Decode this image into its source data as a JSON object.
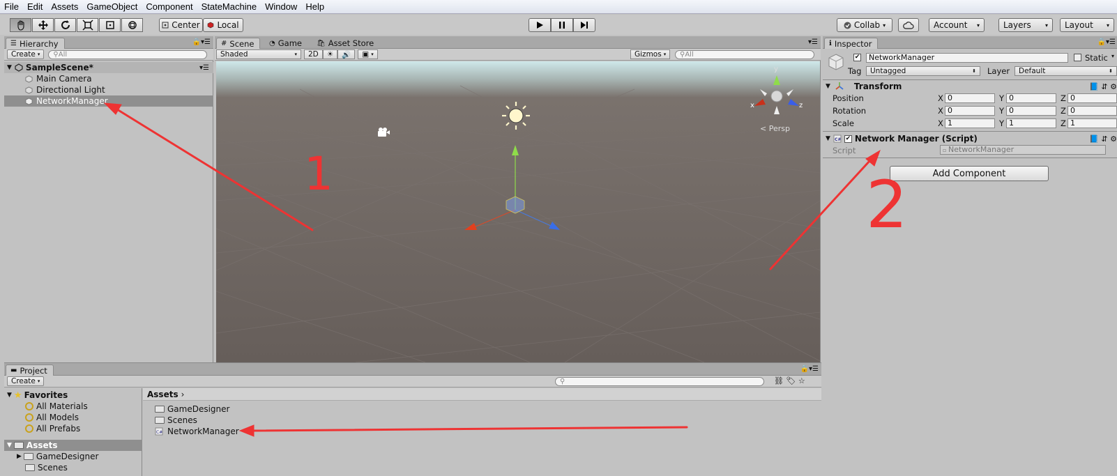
{
  "menu": [
    "File",
    "Edit",
    "Assets",
    "GameObject",
    "Component",
    "StateMachine",
    "Window",
    "Help"
  ],
  "toolbar": {
    "pivot_label": "Center",
    "space_label": "Local",
    "collab_label": "Collab",
    "account_label": "Account",
    "layers_label": "Layers",
    "layout_label": "Layout",
    "play_icon": "play-icon",
    "pause_icon": "pause-icon",
    "step_icon": "step-icon"
  },
  "hierarchy": {
    "tab": "Hierarchy",
    "create": "Create",
    "search_placeholder": "All",
    "scene": "SampleScene*",
    "items": [
      "Main Camera",
      "Directional Light",
      "NetworkManager"
    ],
    "selected_index": 2
  },
  "scene": {
    "tabs": [
      "Scene",
      "Game",
      "Asset Store"
    ],
    "shading": "Shaded",
    "mode_2d": "2D",
    "gizmos": "Gizmos",
    "search_placeholder": "All",
    "persp_label": "Persp",
    "axis_x": "x",
    "axis_y": "y",
    "axis_z": "z"
  },
  "inspector": {
    "tab": "Inspector",
    "object_name": "NetworkManager",
    "static_label": "Static",
    "tag_label": "Tag",
    "tag_value": "Untagged",
    "layer_label": "Layer",
    "layer_value": "Default",
    "transform": {
      "title": "Transform",
      "rows": [
        {
          "label": "Position",
          "x": "0",
          "y": "0",
          "z": "0"
        },
        {
          "label": "Rotation",
          "x": "0",
          "y": "0",
          "z": "0"
        },
        {
          "label": "Scale",
          "x": "1",
          "y": "1",
          "z": "1"
        }
      ],
      "axis_labels": [
        "X",
        "Y",
        "Z"
      ]
    },
    "script_component": {
      "title": "Network Manager (Script)",
      "script_label": "Script",
      "script_value": "NetworkManager"
    },
    "add_component": "Add Component"
  },
  "project": {
    "tab": "Project",
    "create": "Create",
    "favorites_label": "Favorites",
    "favorites": [
      "All Materials",
      "All Models",
      "All Prefabs"
    ],
    "assets_label": "Assets",
    "tree_assets": [
      "GameDesigner",
      "Scenes"
    ],
    "breadcrumb": "Assets",
    "content": [
      {
        "name": "GameDesigner",
        "kind": "folder"
      },
      {
        "name": "Scenes",
        "kind": "folder"
      },
      {
        "name": "NetworkManager",
        "kind": "script"
      }
    ]
  },
  "annotations": {
    "mark_1": "1",
    "mark_2": "2",
    "arrow_color": "#ee3333"
  },
  "colors": {
    "selection": "#8f8f8f",
    "scene_ground": "#6b635f",
    "scene_sky": "#cfe8ea",
    "panel_bg": "#c2c2c2"
  }
}
